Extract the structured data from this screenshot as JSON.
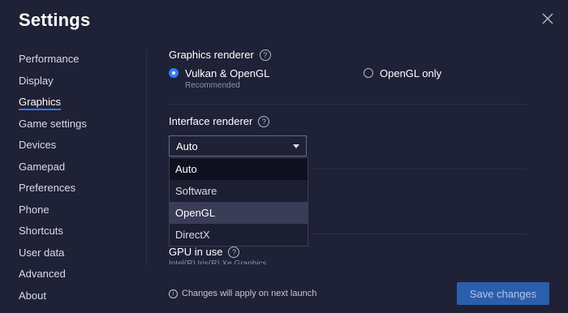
{
  "window": {
    "title": "Settings"
  },
  "sidebar": {
    "items": [
      {
        "label": "Performance",
        "active": false
      },
      {
        "label": "Display",
        "active": false
      },
      {
        "label": "Graphics",
        "active": true
      },
      {
        "label": "Game settings",
        "active": false
      },
      {
        "label": "Devices",
        "active": false
      },
      {
        "label": "Gamepad",
        "active": false
      },
      {
        "label": "Preferences",
        "active": false
      },
      {
        "label": "Phone",
        "active": false
      },
      {
        "label": "Shortcuts",
        "active": false
      },
      {
        "label": "User data",
        "active": false
      },
      {
        "label": "Advanced",
        "active": false
      },
      {
        "label": "About",
        "active": false
      }
    ]
  },
  "graphics_renderer": {
    "title": "Graphics renderer",
    "help_icon": "question-circle-icon",
    "options": [
      {
        "label": "Vulkan & OpenGL",
        "sublabel": "Recommended",
        "checked": true
      },
      {
        "label": "OpenGL only",
        "sublabel": "",
        "checked": false
      }
    ]
  },
  "interface_renderer": {
    "title": "Interface renderer",
    "help_icon": "question-circle-icon",
    "selected": "Auto",
    "dropdown_options": [
      {
        "label": "Auto",
        "state": "selected"
      },
      {
        "label": "Software",
        "state": "normal"
      },
      {
        "label": "OpenGL",
        "state": "hover"
      },
      {
        "label": "DirectX",
        "state": "normal"
      }
    ]
  },
  "gpu": {
    "title": "GPU in use",
    "value": "Intel(R) Iris(R) Xe Graphics"
  },
  "footer": {
    "note": "Changes will apply on next launch",
    "save_label": "Save changes"
  },
  "colors": {
    "background": "#1f2136",
    "accent": "#2f7dff",
    "save_button": "#2a5fae"
  }
}
